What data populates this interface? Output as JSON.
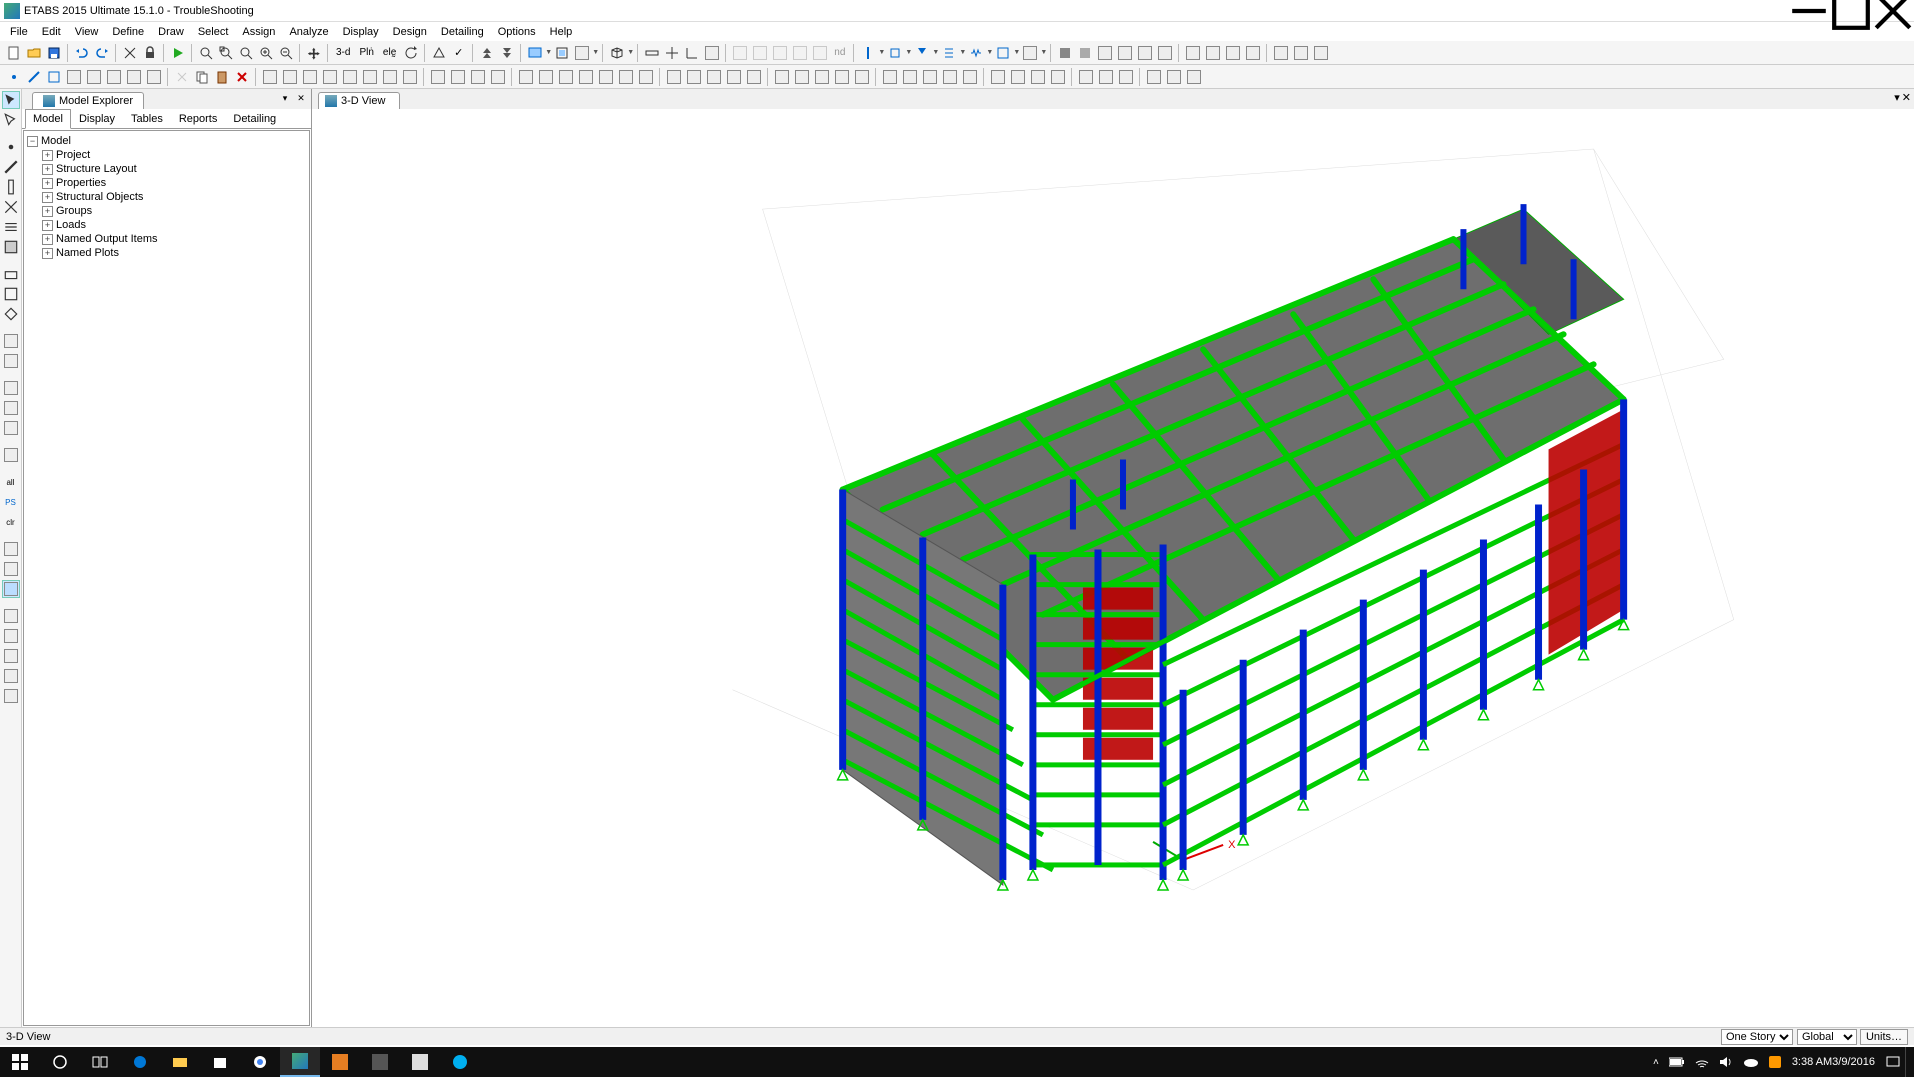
{
  "title": "ETABS 2015 Ultimate 15.1.0 - TroubleShooting",
  "menu": [
    "File",
    "Edit",
    "View",
    "Define",
    "Draw",
    "Select",
    "Assign",
    "Analyze",
    "Display",
    "Design",
    "Detailing",
    "Options",
    "Help"
  ],
  "explorer": {
    "panel_title": "Model Explorer",
    "tabs": [
      "Model",
      "Display",
      "Tables",
      "Reports",
      "Detailing"
    ],
    "active_tab": "Model",
    "root": "Model",
    "children": [
      "Project",
      "Structure Layout",
      "Properties",
      "Structural Objects",
      "Groups",
      "Loads",
      "Named Output Items",
      "Named Plots"
    ]
  },
  "view": {
    "tab_title": "3-D View"
  },
  "toolbar1_text": {
    "threed": "3-d",
    "pln": "Plṅ",
    "ele": "elḛ",
    "nd": "nd"
  },
  "status": {
    "left": "3-D View",
    "story_sel": "One Story",
    "coord_sel": "Global",
    "units_btn": "Units…"
  },
  "taskbar": {
    "time": "3:38 AM",
    "date": "3/9/2016"
  }
}
